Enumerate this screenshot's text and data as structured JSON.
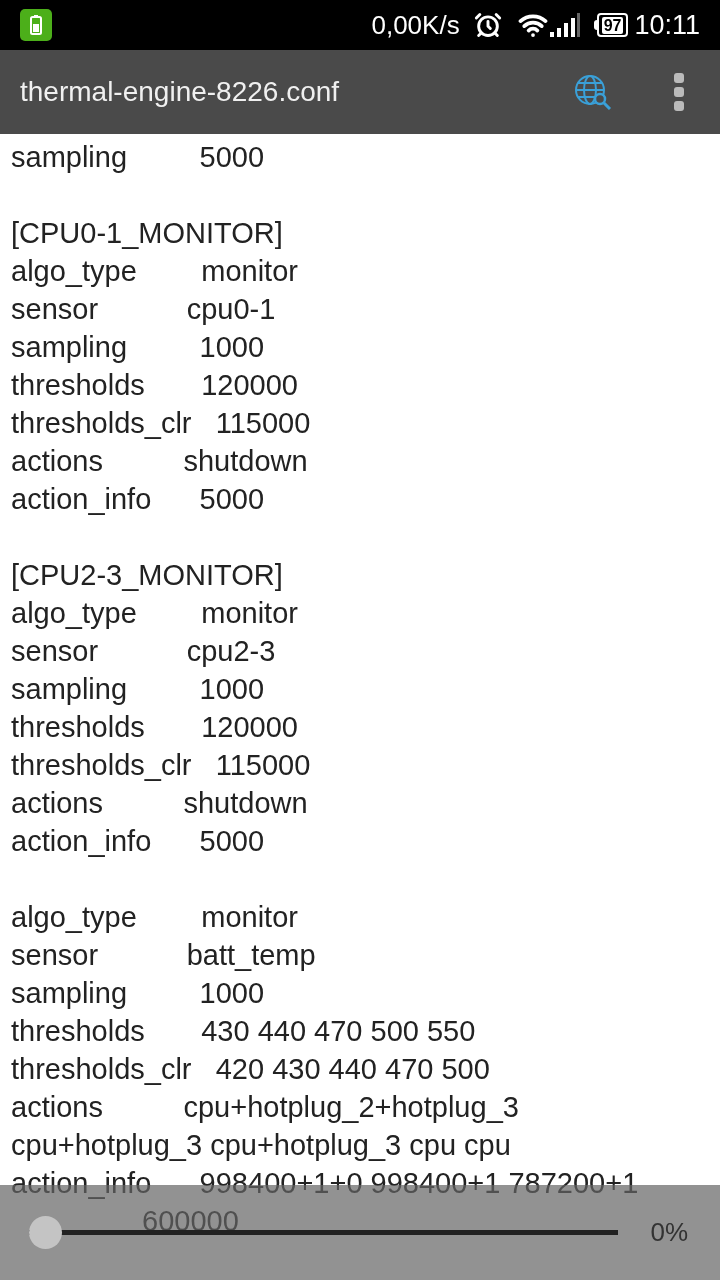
{
  "status_bar": {
    "net_speed": "0,00K/s",
    "battery": "97",
    "time": "10:11"
  },
  "app_bar": {
    "title": "thermal-engine-8226.conf"
  },
  "blocks": [
    {
      "lines": [
        {
          "text": "sampling         5000",
          "kind": "line"
        }
      ]
    },
    {
      "lines": [
        {
          "text": "[CPU0-1_MONITOR]",
          "kind": "line"
        },
        {
          "text": "algo_type        monitor",
          "kind": "line"
        },
        {
          "text": "sensor           cpu0-1",
          "kind": "line"
        },
        {
          "text": "sampling         1000",
          "kind": "line"
        },
        {
          "text": "thresholds       120000",
          "kind": "line"
        },
        {
          "text": "thresholds_clr   115000",
          "kind": "line"
        },
        {
          "text": "actions          shutdown",
          "kind": "line"
        },
        {
          "text": "action_info      5000",
          "kind": "line"
        }
      ]
    },
    {
      "lines": [
        {
          "text": "[CPU2-3_MONITOR]",
          "kind": "line"
        },
        {
          "text": "algo_type        monitor",
          "kind": "line"
        },
        {
          "text": "sensor           cpu2-3",
          "kind": "line"
        },
        {
          "text": "sampling         1000",
          "kind": "line"
        },
        {
          "text": "thresholds       120000",
          "kind": "line"
        },
        {
          "text": "thresholds_clr   115000",
          "kind": "line"
        },
        {
          "text": "actions          shutdown",
          "kind": "line"
        },
        {
          "text": "action_info      5000",
          "kind": "line"
        }
      ]
    },
    {
      "lines": [
        {
          "text": "algo_type        monitor",
          "kind": "line"
        },
        {
          "text": "sensor           batt_temp",
          "kind": "line"
        },
        {
          "text": "sampling         1000",
          "kind": "line"
        },
        {
          "text": "thresholds       430 440 470 500 550",
          "kind": "line"
        },
        {
          "text": "thresholds_clr   420 430 440 470 500",
          "kind": "line"
        },
        {
          "text": "actions          cpu+hotplug_2+hotplug_3",
          "kind": "line"
        },
        {
          "text": "cpu+hotplug_3 cpu+hotplug_3 cpu cpu",
          "kind": "line"
        },
        {
          "text": "action_info      998400+1+0 998400+1 787200+1",
          "kind": "line"
        },
        {
          "text": "600000",
          "kind": "partial"
        }
      ]
    }
  ],
  "scroll_slider": {
    "level": 0,
    "reading": "0%"
  }
}
